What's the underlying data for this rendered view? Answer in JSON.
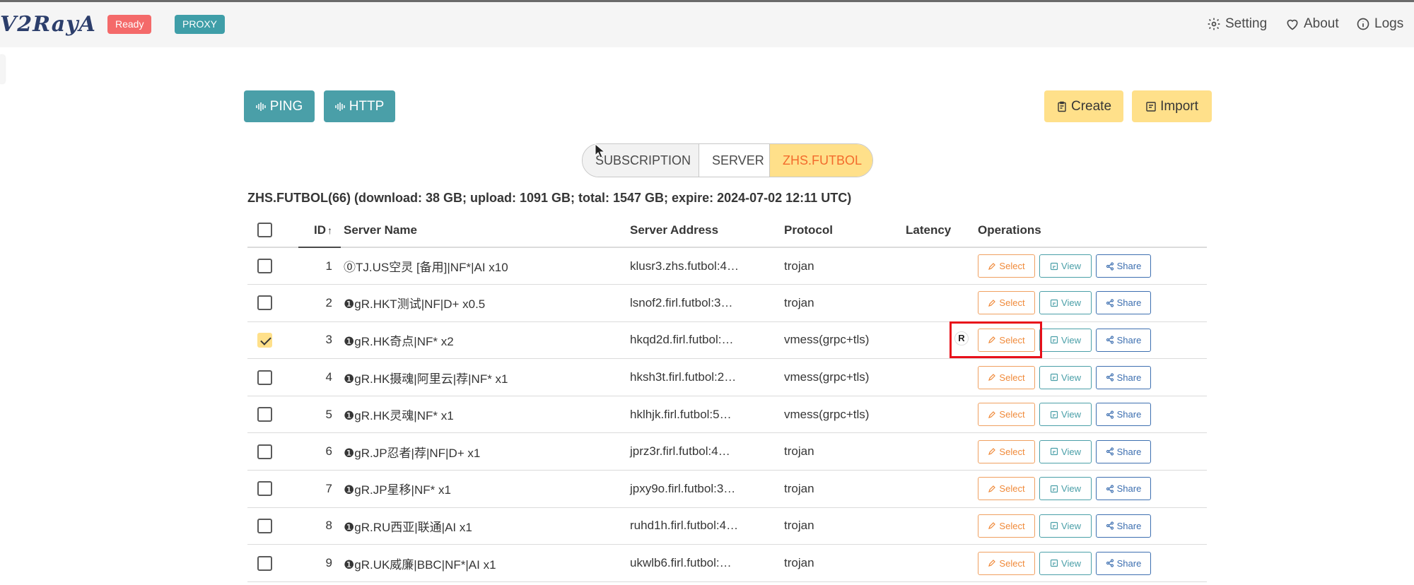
{
  "app": {
    "logo": "V2RayA"
  },
  "header": {
    "status_tag": "Ready",
    "mode_tag": "PROXY",
    "nav": {
      "setting": "Setting",
      "about": "About",
      "logs": "Logs"
    }
  },
  "toolbar": {
    "ping_label": "PING",
    "http_label": "HTTP",
    "create_label": "Create",
    "import_label": "Import"
  },
  "tabs": [
    {
      "label": "SUBSCRIPTION"
    },
    {
      "label": "SERVER"
    },
    {
      "label": "ZHS.FUTBOL",
      "active": true
    }
  ],
  "subscription_info": "ZHS.FUTBOL(66) (download: 38 GB; upload: 1091 GB; total: 1547 GB; expire: 2024-07-02 12:11 UTC)",
  "table": {
    "headers": {
      "id": "ID",
      "id_sort": "↑",
      "name": "Server Name",
      "address": "Server Address",
      "protocol": "Protocol",
      "latency": "Latency",
      "operations": "Operations"
    },
    "op_labels": {
      "select": "Select",
      "view": "View",
      "share": "Share"
    },
    "rows": [
      {
        "id": "1",
        "name": "⓪TJ.US空灵 [备用]|NF*|AI x10",
        "address": "klusr3.zhs.futbol:4…",
        "protocol": "trojan",
        "latency": "",
        "checked": false
      },
      {
        "id": "2",
        "name": "❶gR.HKT测试|NF|D+ x0.5",
        "address": "lsnof2.firl.futbol:3…",
        "protocol": "trojan",
        "latency": "",
        "checked": false
      },
      {
        "id": "3",
        "name": "❶gR.HK奇点|NF* x2",
        "address": "hkqd2d.firl.futbol:…",
        "protocol": "vmess(grpc+tls)",
        "latency": "",
        "checked": true
      },
      {
        "id": "4",
        "name": "❶gR.HK摄魂|阿里云|荐|NF* x1",
        "address": "hksh3t.firl.futbol:2…",
        "protocol": "vmess(grpc+tls)",
        "latency": "",
        "checked": false
      },
      {
        "id": "5",
        "name": "❶gR.HK灵魂|NF* x1",
        "address": "hklhjk.firl.futbol:5…",
        "protocol": "vmess(grpc+tls)",
        "latency": "",
        "checked": false
      },
      {
        "id": "6",
        "name": "❶gR.JP忍者|荐|NF|D+ x1",
        "address": "jprz3r.firl.futbol:4…",
        "protocol": "trojan",
        "latency": "",
        "checked": false
      },
      {
        "id": "7",
        "name": "❶gR.JP星移|NF* x1",
        "address": "jpxy9o.firl.futbol:3…",
        "protocol": "trojan",
        "latency": "",
        "checked": false
      },
      {
        "id": "8",
        "name": "❶gR.RU西亚|联通|AI x1",
        "address": "ruhd1h.firl.futbol:4…",
        "protocol": "trojan",
        "latency": "",
        "checked": false
      },
      {
        "id": "9",
        "name": "❶gR.UK威廉|BBC|NF*|AI x1",
        "address": "ukwlb6.firl.futbol:…",
        "protocol": "trojan",
        "latency": "",
        "checked": false
      }
    ]
  },
  "overlay": {
    "badge": "R"
  },
  "colors": {
    "primary": "#4a9fa8",
    "warning": "#ffe08a",
    "danger": "#f46a6a",
    "highlight": "#e8101a"
  }
}
